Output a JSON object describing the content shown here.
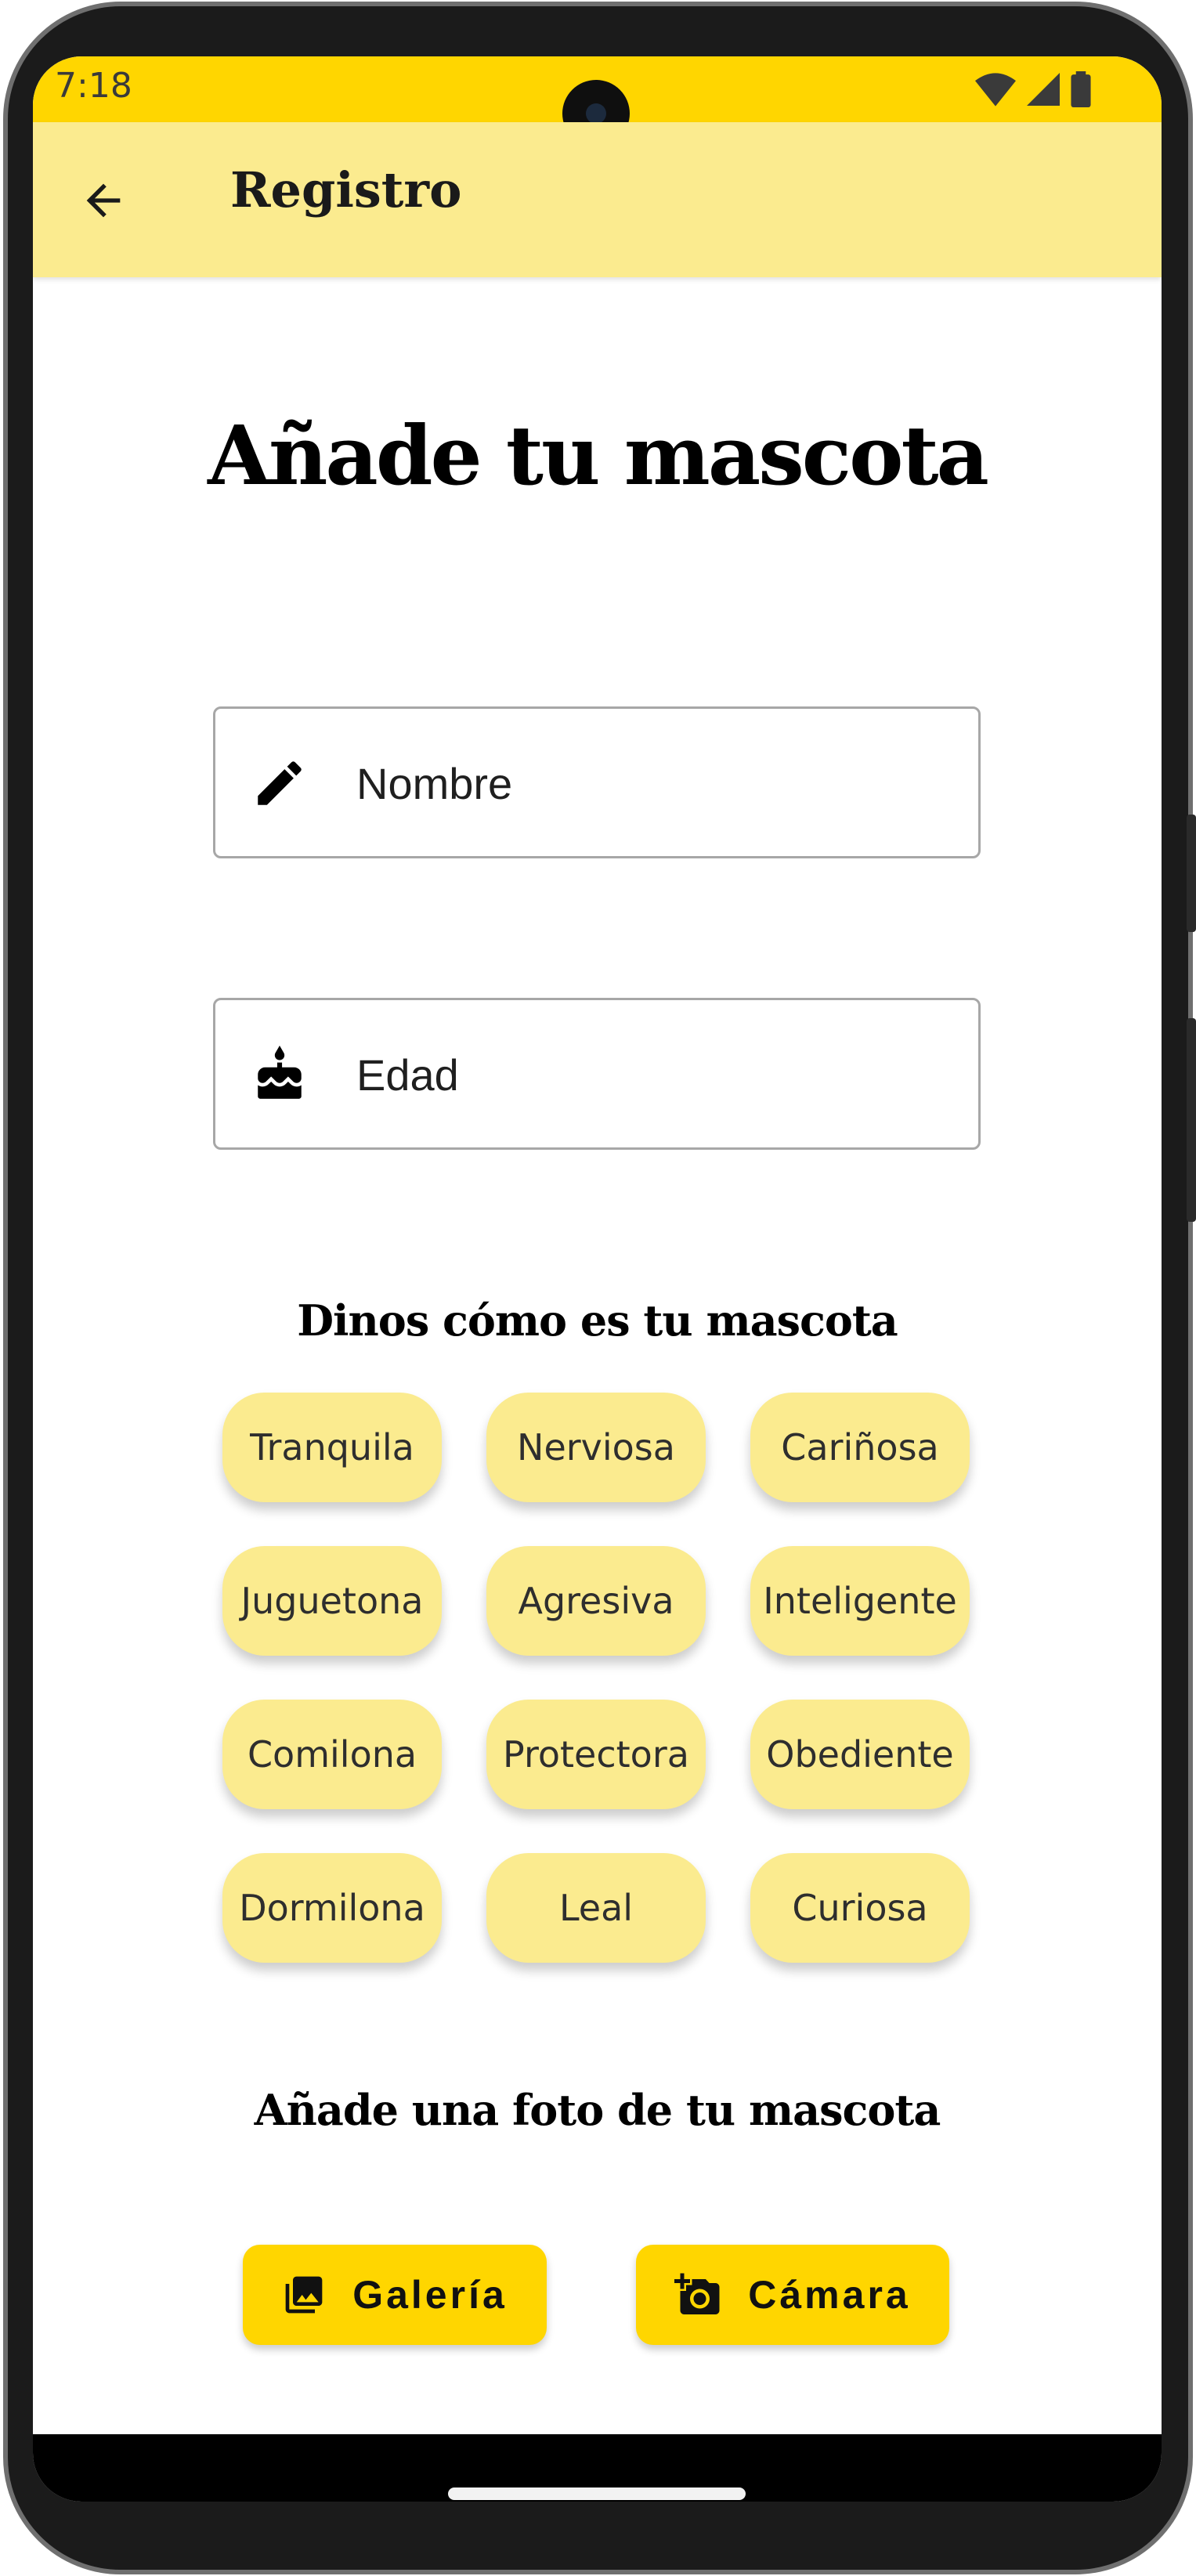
{
  "status_bar": {
    "time": "7:18",
    "icons": [
      "wifi-icon",
      "signal-icon",
      "battery-icon"
    ]
  },
  "app_bar": {
    "back_icon": "arrow-back-icon",
    "title": "Registro"
  },
  "form": {
    "heading": "Añade tu mascota",
    "name_field": {
      "placeholder": "Nombre",
      "value": "",
      "icon": "pencil-icon"
    },
    "age_field": {
      "placeholder": "Edad",
      "value": "",
      "icon": "cake-icon"
    }
  },
  "traits": {
    "label": "Dinos cómo es tu mascota",
    "chips": [
      "Tranquila",
      "Nerviosa",
      "Cariñosa",
      "Juguetona",
      "Agresiva",
      "Inteligente",
      "Comilona",
      "Protectora",
      "Obediente",
      "Dormilona",
      "Leal",
      "Curiosa"
    ]
  },
  "photo": {
    "label": "Añade una foto de tu mascota",
    "gallery_label": "Galería",
    "gallery_icon": "photo-library-icon",
    "camera_label": "Cámara",
    "camera_icon": "add-camera-icon"
  },
  "colors": {
    "accent": "#ffd600",
    "surface": "#fbeb8f",
    "background": "#ffffff"
  }
}
